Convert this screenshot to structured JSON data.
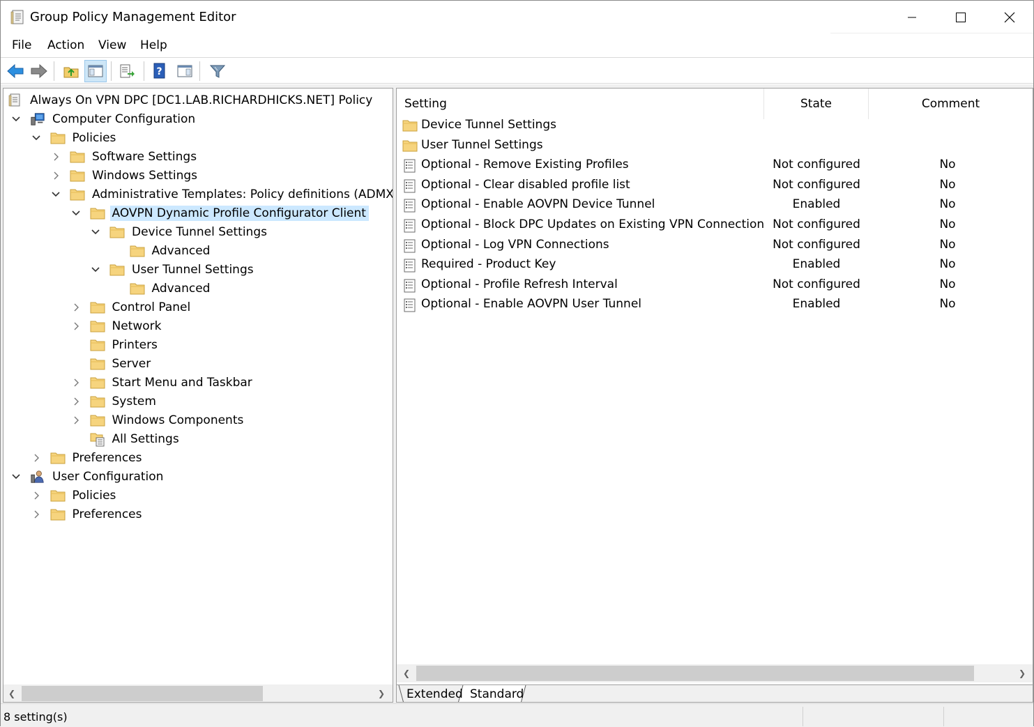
{
  "window": {
    "title": "Group Policy Management Editor"
  },
  "menu": [
    "File",
    "Action",
    "View",
    "Help"
  ],
  "toolbar": {
    "buttons": [
      "back-icon",
      "forward-icon",
      "up-folder-icon",
      "show-hide-tree-icon",
      "export-list-icon",
      "help-icon",
      "action-pane-icon",
      "filter-icon"
    ]
  },
  "tree": {
    "root": "Always On VPN DPC [DC1.LAB.RICHARDHICKS.NET] Policy",
    "items": [
      "Computer Configuration",
      "Policies",
      "Software Settings",
      "Windows Settings",
      "Administrative Templates: Policy definitions (ADMX files)",
      "AOVPN Dynamic Profile Configurator Client",
      "Device Tunnel Settings",
      "Advanced",
      "User Tunnel Settings",
      "Advanced",
      "Control Panel",
      "Network",
      "Printers",
      "Server",
      "Start Menu and Taskbar",
      "System",
      "Windows Components",
      "All Settings",
      "Preferences",
      "User Configuration",
      "Policies",
      "Preferences"
    ]
  },
  "table": {
    "columns": [
      "Setting",
      "State",
      "Comment"
    ],
    "folders": [
      "Device Tunnel Settings",
      "User Tunnel Settings"
    ],
    "rows": [
      {
        "setting": "Optional - Remove Existing Profiles",
        "state": "Not configured",
        "comment": "No"
      },
      {
        "setting": "Optional - Clear disabled profile list",
        "state": "Not configured",
        "comment": "No"
      },
      {
        "setting": "Optional - Enable AOVPN Device Tunnel",
        "state": "Enabled",
        "comment": "No"
      },
      {
        "setting": "Optional - Block DPC Updates on Existing VPN Connection",
        "state": "Not configured",
        "comment": "No"
      },
      {
        "setting": "Optional - Log VPN Connections",
        "state": "Not configured",
        "comment": "No"
      },
      {
        "setting": "Required - Product Key",
        "state": "Enabled",
        "comment": "No"
      },
      {
        "setting": "Optional - Profile Refresh Interval",
        "state": "Not configured",
        "comment": "No"
      },
      {
        "setting": "Optional - Enable AOVPN User Tunnel",
        "state": "Enabled",
        "comment": "No"
      }
    ]
  },
  "tabs": [
    "Extended",
    "Standard"
  ],
  "status": {
    "text": "8 setting(s)"
  }
}
